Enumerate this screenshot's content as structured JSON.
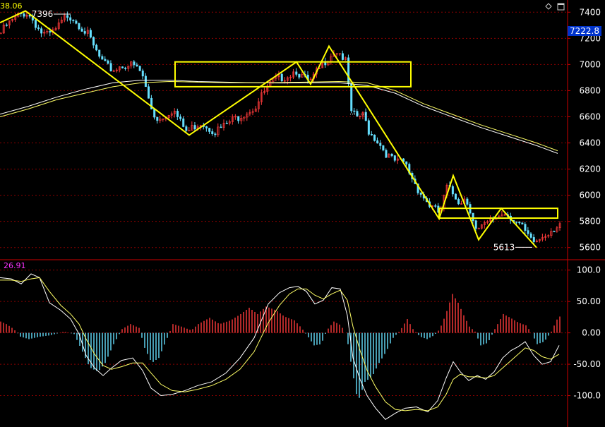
{
  "header": {
    "top_left_value": "38.06",
    "current_price_tag": "7222.8"
  },
  "oscillator": {
    "value_label": "26.91"
  },
  "colors": {
    "background": "#000000",
    "grid": "#8b0000",
    "candle_up": "#ff3b3b",
    "candle_down": "#66e0ff",
    "ma_white": "#ffffff",
    "ma_yellow": "#ffff66",
    "annotation": "#ffff00",
    "price_tag_bg": "#0033cc",
    "osc_label": "#ff33ff"
  },
  "icons": [
    "diamond-icon",
    "window-icon"
  ],
  "chart_data": [
    {
      "type": "line",
      "subtype": "candlestick",
      "ylim": [
        5550,
        7450
      ],
      "yticks": [
        5600,
        5800,
        6000,
        6200,
        6400,
        6600,
        6800,
        7000,
        7200,
        7400
      ],
      "ytick_labels": [
        "5600",
        "5800",
        "6000",
        "6200",
        "6400",
        "6600",
        "6800",
        "7000",
        "7200",
        "7400"
      ],
      "bars": 194,
      "close_path": [
        [
          0,
          7240
        ],
        [
          8,
          7300
        ],
        [
          16,
          7330
        ],
        [
          24,
          7370
        ],
        [
          36,
          7400
        ],
        [
          46,
          7340
        ],
        [
          56,
          7250
        ],
        [
          66,
          7220
        ],
        [
          76,
          7250
        ],
        [
          86,
          7320
        ],
        [
          94,
          7380
        ],
        [
          102,
          7360
        ],
        [
          112,
          7300
        ],
        [
          122,
          7240
        ],
        [
          132,
          7130
        ],
        [
          142,
          7030
        ],
        [
          150,
          6980
        ],
        [
          160,
          6960
        ],
        [
          170,
          6990
        ],
        [
          180,
          7000
        ],
        [
          190,
          6985
        ],
        [
          200,
          6930
        ],
        [
          208,
          6760
        ],
        [
          216,
          6620
        ],
        [
          224,
          6580
        ],
        [
          234,
          6620
        ],
        [
          244,
          6660
        ],
        [
          254,
          6560
        ],
        [
          264,
          6480
        ],
        [
          274,
          6530
        ],
        [
          284,
          6560
        ],
        [
          294,
          6520
        ],
        [
          304,
          6490
        ],
        [
          314,
          6520
        ],
        [
          324,
          6560
        ],
        [
          336,
          6600
        ],
        [
          348,
          6640
        ],
        [
          360,
          6670
        ],
        [
          372,
          6780
        ],
        [
          384,
          6860
        ],
        [
          396,
          6900
        ],
        [
          408,
          6920
        ],
        [
          418,
          6960
        ],
        [
          428,
          6900
        ],
        [
          438,
          6860
        ],
        [
          448,
          6940
        ],
        [
          458,
          7020
        ],
        [
          466,
          7070
        ],
        [
          474,
          7110
        ],
        [
          482,
          7080
        ],
        [
          490,
          7000
        ],
        [
          496,
          6620
        ],
        [
          504,
          6600
        ],
        [
          514,
          6610
        ],
        [
          522,
          6480
        ],
        [
          532,
          6430
        ],
        [
          542,
          6350
        ],
        [
          552,
          6280
        ],
        [
          562,
          6250
        ],
        [
          572,
          6250
        ],
        [
          582,
          6140
        ],
        [
          592,
          6040
        ],
        [
          602,
          5960
        ],
        [
          612,
          5900
        ],
        [
          622,
          5860
        ],
        [
          632,
          6060
        ],
        [
          642,
          6000
        ],
        [
          650,
          5950
        ],
        [
          658,
          5980
        ],
        [
          666,
          5880
        ],
        [
          674,
          5720
        ],
        [
          684,
          5760
        ],
        [
          694,
          5800
        ],
        [
          704,
          5840
        ],
        [
          714,
          5870
        ],
        [
          724,
          5830
        ],
        [
          734,
          5780
        ],
        [
          742,
          5720
        ],
        [
          752,
          5640
        ],
        [
          760,
          5650
        ],
        [
          770,
          5700
        ],
        [
          780,
          5740
        ],
        [
          792,
          5780
        ]
      ],
      "series": [
        {
          "name": "",
          "x": [
            0,
            40,
            80,
            120,
            160,
            200,
            240,
            280,
            320,
            360,
            400,
            440,
            480,
            520,
            560,
            600,
            640,
            680,
            720,
            760,
            790
          ],
          "values": [
            6620,
            6680,
            6750,
            6810,
            6860,
            6880,
            6880,
            6870,
            6865,
            6860,
            6858,
            6860,
            6860,
            6840,
            6780,
            6680,
            6600,
            6520,
            6450,
            6380,
            6320
          ]
        },
        {
          "name": "",
          "x": [
            0,
            40,
            80,
            120,
            160,
            200,
            240,
            280,
            320,
            360,
            400,
            440,
            480,
            520,
            560,
            600,
            640,
            680,
            720,
            760,
            790
          ],
          "values": [
            6600,
            6660,
            6730,
            6780,
            6830,
            6860,
            6870,
            6865,
            6860,
            6860,
            6862,
            6866,
            6870,
            6860,
            6800,
            6700,
            6620,
            6540,
            6470,
            6400,
            6340
          ]
        }
      ],
      "annotations": {
        "zigzag": [
          [
            0,
            7320
          ],
          [
            36,
            7410
          ],
          [
            268,
            6460
          ],
          [
            420,
            7020
          ],
          [
            440,
            6850
          ],
          [
            466,
            7140
          ],
          [
            622,
            5820
          ],
          [
            642,
            6150
          ],
          [
            678,
            5660
          ],
          [
            710,
            5900
          ],
          [
            760,
            5600
          ]
        ],
        "boxes": [
          {
            "x0": 248,
            "y0": 6830,
            "x1": 582,
            "y1": 7020
          },
          {
            "x0": 622,
            "y0": 5825,
            "x1": 790,
            "y1": 5900
          }
        ],
        "labels": [
          {
            "text": "7396",
            "x": 60,
            "value": 7396
          },
          {
            "text": "5613",
            "x": 714,
            "value": 5613
          }
        ]
      }
    },
    {
      "type": "bar",
      "subtype": "macd",
      "ylim": [
        -150,
        112
      ],
      "yticks": [
        100,
        50,
        0,
        -50,
        -100
      ],
      "ytick_labels": [
        "100.0",
        "50.00",
        "0.00",
        "-50.00",
        "-100.0"
      ],
      "histogram_envelope": [
        [
          0,
          18
        ],
        [
          8,
          14
        ],
        [
          16,
          8
        ],
        [
          22,
          2
        ],
        [
          28,
          -6
        ],
        [
          40,
          -10
        ],
        [
          56,
          -6
        ],
        [
          70,
          -4
        ],
        [
          90,
          2
        ],
        [
          104,
          -2
        ],
        [
          116,
          -30
        ],
        [
          126,
          -55
        ],
        [
          138,
          -62
        ],
        [
          148,
          -48
        ],
        [
          160,
          -18
        ],
        [
          172,
          6
        ],
        [
          184,
          14
        ],
        [
          196,
          8
        ],
        [
          204,
          -24
        ],
        [
          214,
          -48
        ],
        [
          224,
          -40
        ],
        [
          236,
          -8
        ],
        [
          244,
          14
        ],
        [
          256,
          10
        ],
        [
          270,
          4
        ],
        [
          280,
          14
        ],
        [
          296,
          24
        ],
        [
          310,
          14
        ],
        [
          326,
          20
        ],
        [
          340,
          30
        ],
        [
          352,
          40
        ],
        [
          364,
          30
        ],
        [
          376,
          42
        ],
        [
          390,
          36
        ],
        [
          402,
          26
        ],
        [
          416,
          20
        ],
        [
          426,
          8
        ],
        [
          434,
          -4
        ],
        [
          444,
          -20
        ],
        [
          454,
          -18
        ],
        [
          462,
          4
        ],
        [
          472,
          18
        ],
        [
          482,
          12
        ],
        [
          490,
          -4
        ],
        [
          498,
          -60
        ],
        [
          506,
          -110
        ],
        [
          516,
          -78
        ],
        [
          526,
          -70
        ],
        [
          536,
          -48
        ],
        [
          546,
          -30
        ],
        [
          556,
          -8
        ],
        [
          566,
          4
        ],
        [
          576,
          22
        ],
        [
          584,
          6
        ],
        [
          594,
          -6
        ],
        [
          604,
          -10
        ],
        [
          614,
          -4
        ],
        [
          622,
          6
        ],
        [
          630,
          28
        ],
        [
          640,
          62
        ],
        [
          648,
          48
        ],
        [
          656,
          28
        ],
        [
          664,
          10
        ],
        [
          672,
          2
        ],
        [
          680,
          -20
        ],
        [
          690,
          -16
        ],
        [
          700,
          6
        ],
        [
          712,
          30
        ],
        [
          722,
          24
        ],
        [
          734,
          16
        ],
        [
          744,
          12
        ],
        [
          752,
          0
        ],
        [
          760,
          -18
        ],
        [
          770,
          -14
        ],
        [
          780,
          2
        ],
        [
          790,
          26
        ]
      ],
      "series": [
        {
          "name": "",
          "x": [
            0,
            16,
            30,
            44,
            56,
            70,
            86,
            100,
            112,
            122,
            134,
            146,
            158,
            172,
            188,
            202,
            214,
            228,
            244,
            262,
            280,
            300,
            320,
            340,
            360,
            380,
            396,
            410,
            422,
            434,
            446,
            458,
            470,
            482,
            492,
            500,
            510,
            520,
            532,
            546,
            560,
            574,
            590,
            606,
            620,
            632,
            642,
            652,
            664,
            676,
            688,
            700,
            712,
            724,
            734,
            744,
            756,
            768,
            780,
            792
          ],
          "values": [
            88,
            86,
            78,
            94,
            88,
            48,
            36,
            22,
            -2,
            -36,
            -56,
            -68,
            -56,
            -44,
            -40,
            -60,
            -88,
            -100,
            -98,
            -92,
            -84,
            -78,
            -64,
            -40,
            -8,
            46,
            64,
            72,
            74,
            66,
            46,
            52,
            72,
            70,
            28,
            -40,
            -74,
            -100,
            -120,
            -138,
            -128,
            -120,
            -118,
            -126,
            -108,
            -72,
            -46,
            -62,
            -76,
            -68,
            -74,
            -62,
            -40,
            -28,
            -22,
            -14,
            -36,
            -50,
            -46,
            -20
          ]
        },
        {
          "name": "",
          "x": [
            0,
            16,
            30,
            44,
            56,
            70,
            86,
            100,
            112,
            122,
            134,
            146,
            158,
            172,
            188,
            202,
            214,
            228,
            244,
            262,
            280,
            300,
            320,
            340,
            360,
            380,
            396,
            410,
            422,
            434,
            446,
            458,
            470,
            482,
            492,
            500,
            510,
            520,
            532,
            546,
            560,
            574,
            590,
            606,
            620,
            632,
            642,
            652,
            664,
            676,
            688,
            700,
            712,
            724,
            734,
            744,
            756,
            768,
            780,
            792
          ],
          "values": [
            84,
            84,
            82,
            86,
            88,
            66,
            44,
            30,
            14,
            -10,
            -34,
            -52,
            -58,
            -54,
            -48,
            -48,
            -64,
            -82,
            -92,
            -94,
            -90,
            -84,
            -74,
            -58,
            -30,
            16,
            44,
            62,
            70,
            70,
            60,
            54,
            62,
            68,
            52,
            10,
            -28,
            -60,
            -86,
            -110,
            -122,
            -124,
            -122,
            -124,
            -118,
            -98,
            -74,
            -66,
            -70,
            -70,
            -72,
            -68,
            -56,
            -44,
            -34,
            -24,
            -28,
            -38,
            -42,
            -34
          ]
        }
      ]
    }
  ]
}
